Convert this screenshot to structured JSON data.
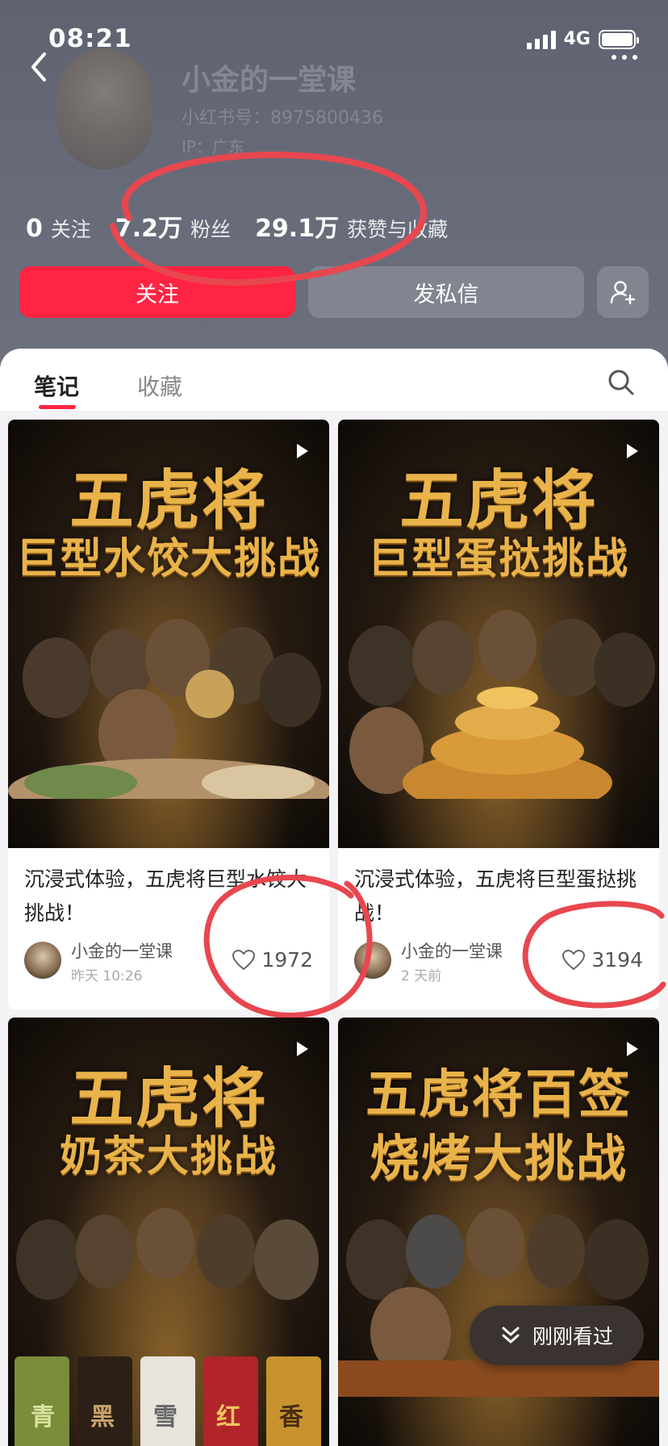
{
  "status_bar": {
    "time": "08:21",
    "network": "4G"
  },
  "profile": {
    "name": "小金的一堂课",
    "id_line": "小红书号：8975800436",
    "ip_line": "IP：广东"
  },
  "stats": [
    {
      "value": "0",
      "label": "关注"
    },
    {
      "value": "7.2万",
      "label": "粉丝"
    },
    {
      "value": "29.1万",
      "label": "获赞与收藏"
    }
  ],
  "actions": {
    "follow": "关注",
    "message": "发私信"
  },
  "tabs": {
    "notes": "笔记",
    "collections": "收藏"
  },
  "cards": [
    {
      "cover_line1": "五虎将",
      "cover_line2": "巨型水饺大挑战",
      "title": "沉浸式体验，五虎将巨型水饺大挑战！",
      "author": "小金的一堂课",
      "time": "昨天 10:26",
      "likes": "1972"
    },
    {
      "cover_line1": "五虎将",
      "cover_line2": "巨型蛋挞挑战",
      "title": "沉浸式体验，五虎将巨型蛋挞挑战！",
      "author": "小金的一堂课",
      "time": "2 天前",
      "likes": "3194"
    },
    {
      "cover_line1": "五虎将",
      "cover_line2": "奶茶大挑战",
      "cup_labels": [
        "青",
        "黑",
        "雪",
        "红",
        "香"
      ]
    },
    {
      "cover_line1": "五虎将百签",
      "cover_line2": "烧烤大挑战"
    }
  ],
  "recent_pill": "刚刚看过",
  "colors": {
    "accent_red": "#ff2442",
    "header_bg": "#666a78",
    "cover_gold": "#e9b34a",
    "annotation_red": "#e8474f"
  }
}
